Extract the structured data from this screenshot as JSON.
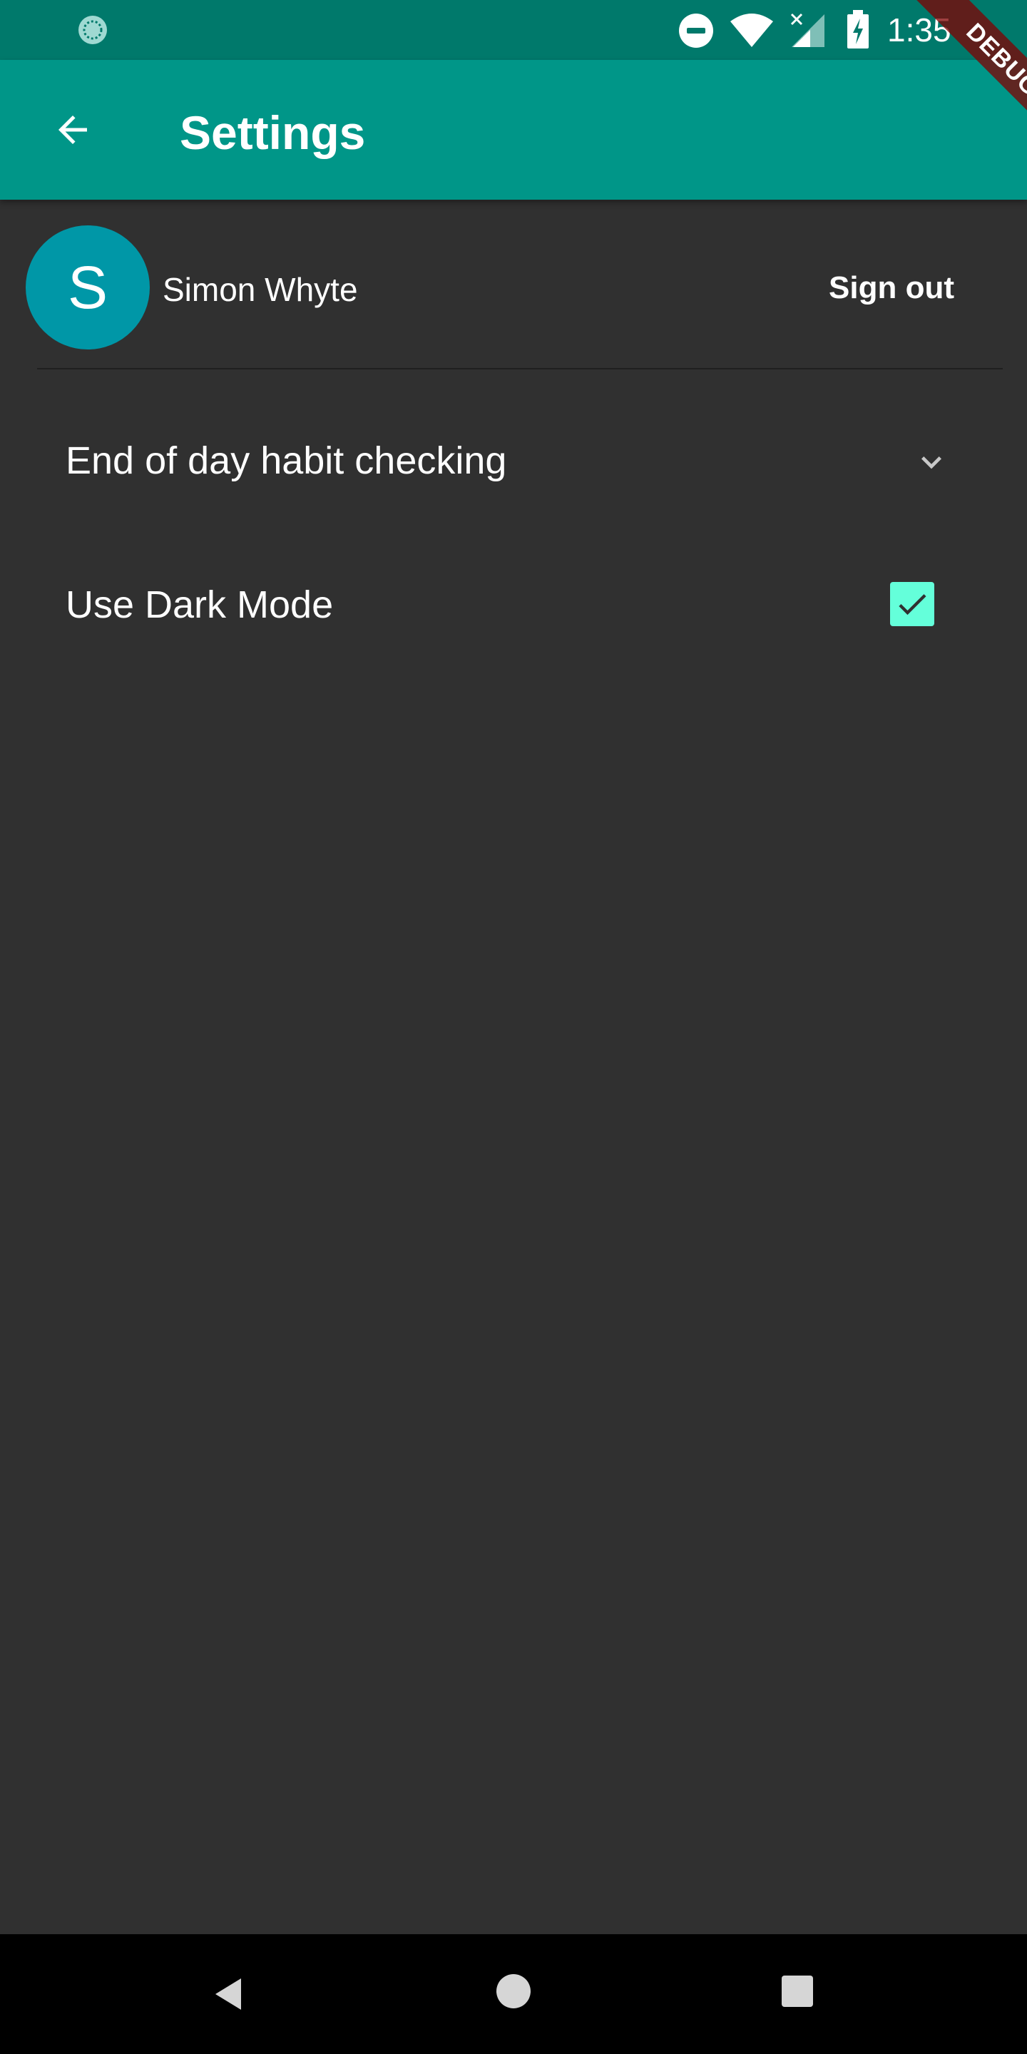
{
  "status_bar": {
    "time": "1:35",
    "icons": [
      "app-notification-icon",
      "do-not-disturb-icon",
      "wifi-icon",
      "cell-signal-icon",
      "battery-charging-icon"
    ]
  },
  "app_bar": {
    "title": "Settings",
    "back_icon": "arrow-back-icon",
    "debug_banner": "DEBUG"
  },
  "account": {
    "avatar_initial": "S",
    "name": "Simon Whyte",
    "sign_out_label": "Sign out"
  },
  "settings": {
    "end_of_day": {
      "label": "End of day habit checking",
      "icon": "chevron-down-icon"
    },
    "dark_mode": {
      "label": "Use Dark Mode",
      "checked": true
    }
  },
  "colors": {
    "status_bar": "#00796b",
    "app_bar": "#009688",
    "background": "#303030",
    "avatar": "#0097a7",
    "checkbox_accent": "#64ffda",
    "debug_banner": "#800000"
  },
  "nav_bar": {
    "icons": [
      "nav-back-icon",
      "nav-home-icon",
      "nav-recents-icon"
    ]
  }
}
